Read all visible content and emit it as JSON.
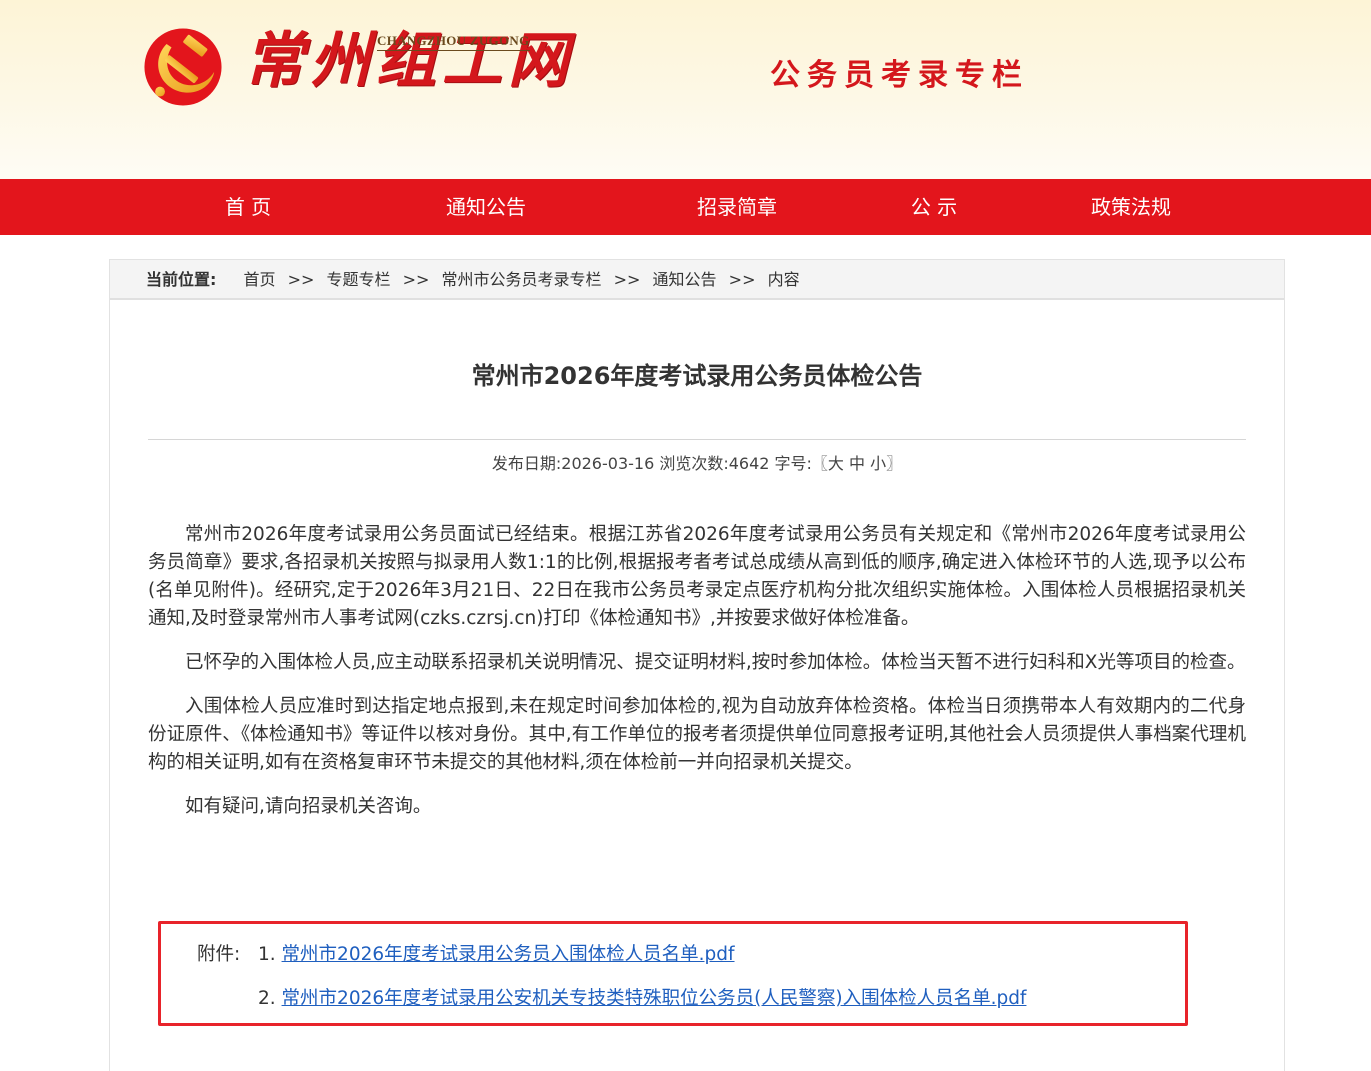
{
  "header": {
    "logo_cn": "常州组工网",
    "logo_en": "CHANGZHOU ZUGONG",
    "column_title": "公务员考录专栏"
  },
  "nav": {
    "items": [
      "首 页",
      "通知公告",
      "招录简章",
      "公 示",
      "政策法规"
    ]
  },
  "breadcrumb": {
    "label": "当前位置:",
    "items": [
      "首页",
      "专题专栏",
      "常州市公务员考录专栏",
      "通知公告",
      "内容"
    ],
    "separator": ">>"
  },
  "article": {
    "title": "常州市2026年度考试录用公务员体检公告",
    "meta": "发布日期:2026-03-16 浏览次数:4642 字号:〖大 中 小〗",
    "paragraphs": [
      "常州市2026年度考试录用公务员面试已经结束。根据江苏省2026年度考试录用公务员有关规定和《常州市2026年度考试录用公务员简章》要求,各招录机关按照与拟录用人数1:1的比例,根据报考者考试总成绩从高到低的顺序,确定进入体检环节的人选,现予以公布(名单见附件)。经研究,定于2026年3月21日、22日在我市公务员考录定点医疗机构分批次组织实施体检。入围体检人员根据招录机关通知,及时登录常州市人事考试网(czks.czrsj.cn)打印《体检通知书》,并按要求做好体检准备。",
      "已怀孕的入围体检人员,应主动联系招录机关说明情况、提交证明材料,按时参加体检。体检当天暂不进行妇科和X光等项目的检查。",
      "入围体检人员应准时到达指定地点报到,未在规定时间参加体检的,视为自动放弃体检资格。体检当日须携带本人有效期内的二代身份证原件、《体检通知书》等证件以核对身份。其中,有工作单位的报考者须提供单位同意报考证明,其他社会人员须提供人事档案代理机构的相关证明,如有在资格复审环节未提交的其他材料,须在体检前一并向招录机关提交。",
      "如有疑问,请向招录机关咨询。"
    ]
  },
  "attachments": {
    "label": "附件:",
    "items": [
      {
        "num": "1.",
        "name": "常州市2026年度考试录用公务员入围体检人员名单.pdf"
      },
      {
        "num": "2.",
        "name": "常州市2026年度考试录用公安机关专技类特殊职位公务员(人民警察)入围体检人员名单.pdf"
      }
    ]
  },
  "colors": {
    "brand_red": "#e3151c",
    "link_blue": "#1f5fbf",
    "highlight_border": "#e8232a",
    "emblem_gold": "#f2b632"
  },
  "icons": {
    "emblem": "party-emblem-icon"
  }
}
